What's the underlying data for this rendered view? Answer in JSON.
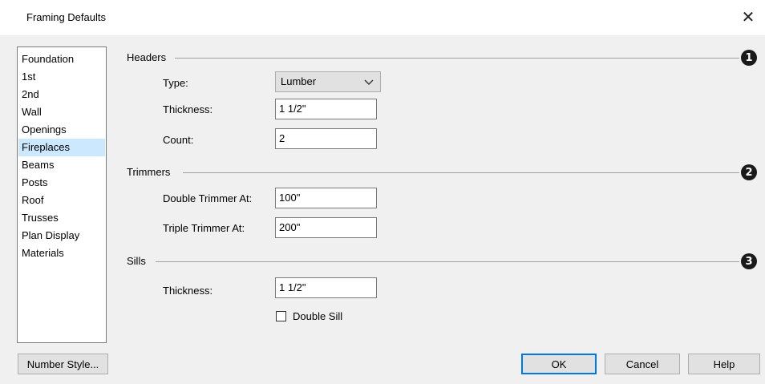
{
  "window": {
    "title": "Framing Defaults",
    "close_glyph": "✕"
  },
  "nav": {
    "selected": "Fireplaces",
    "items": [
      "Foundation",
      "1st",
      "2nd",
      "Wall",
      "Openings",
      "Fireplaces",
      "Beams",
      "Posts",
      "Roof",
      "Trusses",
      "Plan Display",
      "Materials"
    ]
  },
  "headers": {
    "label": "Headers",
    "badge": "1",
    "type_label": "Type:",
    "type_value": "Lumber",
    "thickness_label": "Thickness:",
    "thickness_value": "1 1/2\"",
    "count_label": "Count:",
    "count_value": "2"
  },
  "trimmers": {
    "label": "Trimmers",
    "badge": "2",
    "double_label": "Double Trimmer At:",
    "double_value": "100\"",
    "triple_label": "Triple Trimmer At:",
    "triple_value": "200\""
  },
  "sills": {
    "label": "Sills",
    "badge": "3",
    "thickness_label": "Thickness:",
    "thickness_value": "1 1/2\"",
    "double_sill_label": "Double Sill",
    "double_sill_checked": false
  },
  "buttons": {
    "number_style": "Number Style...",
    "ok": "OK",
    "cancel": "Cancel",
    "help": "Help"
  },
  "colors": {
    "selection": "#cce8ff",
    "default_button_border": "#0078d7"
  }
}
